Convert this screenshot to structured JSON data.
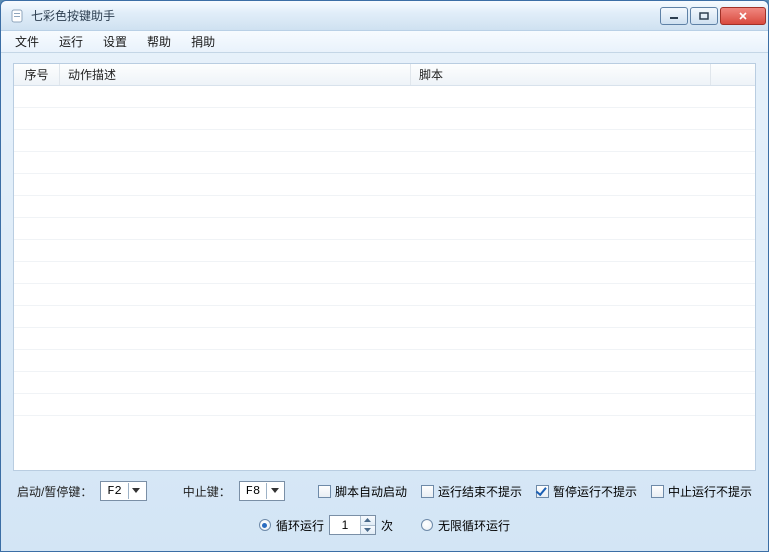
{
  "window": {
    "title": "七彩色按键助手"
  },
  "menu": {
    "file": "文件",
    "run": "运行",
    "settings": "设置",
    "help": "帮助",
    "donate": "捐助"
  },
  "table": {
    "headers": {
      "index": "序号",
      "desc": "动作描述",
      "script": "脚本"
    }
  },
  "controls": {
    "start_pause_label": "启动/暂停键：",
    "start_pause_key": "F2",
    "stop_label": "中止键：",
    "stop_key": "F8",
    "auto_start": "脚本自动启动",
    "no_prompt_end": "运行结束不提示",
    "no_prompt_pause": "暂停运行不提示",
    "no_prompt_stop": "中止运行不提示",
    "loop_run": "循环运行",
    "loop_times_value": "1",
    "loop_times_suffix": "次",
    "infinite_loop": "无限循环运行"
  },
  "checked": {
    "auto_start": false,
    "no_prompt_end": false,
    "no_prompt_pause": true,
    "no_prompt_stop": false
  },
  "radio": {
    "loop_mode": "times"
  }
}
